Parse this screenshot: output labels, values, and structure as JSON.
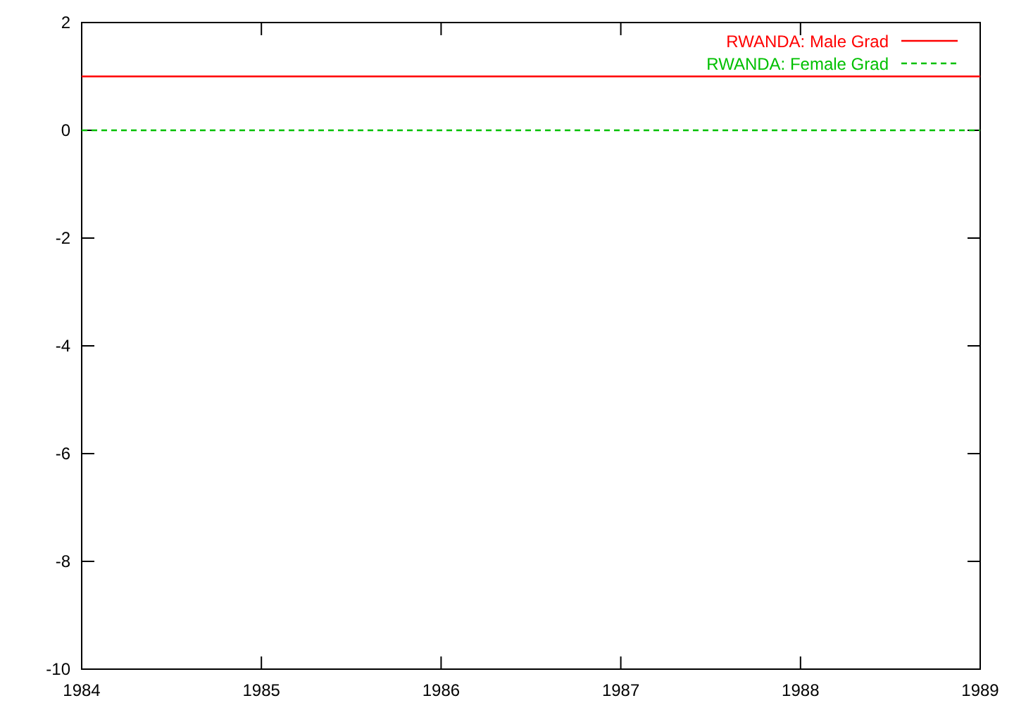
{
  "chart_data": {
    "type": "line",
    "x": [
      1984,
      1989
    ],
    "series": [
      {
        "name": "RWANDA: Male Grad",
        "color": "#ff0000",
        "line_style": "solid",
        "values": [
          1,
          1
        ]
      },
      {
        "name": "RWANDA: Female Grad",
        "color": "#00c000",
        "line_style": "dashed",
        "values": [
          0,
          0
        ]
      }
    ],
    "xlim": [
      1984,
      1989
    ],
    "ylim": [
      -10,
      2
    ],
    "xticks": [
      1984,
      1985,
      1986,
      1987,
      1988,
      1989
    ],
    "yticks": [
      -10,
      -8,
      -6,
      -4,
      -2,
      0,
      2
    ],
    "legend": "upper right"
  }
}
